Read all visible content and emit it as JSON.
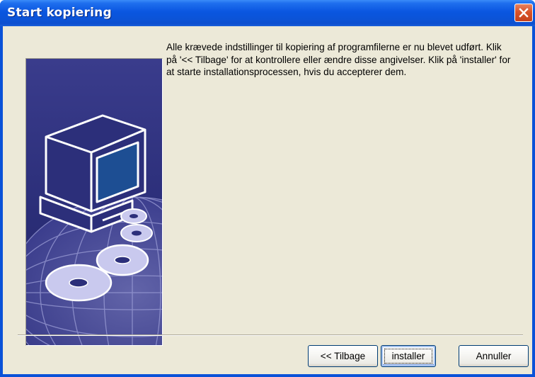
{
  "window": {
    "title": "Start kopiering"
  },
  "icons": {
    "close": "close-icon",
    "illustration": "computer-with-discs-illustration"
  },
  "content": {
    "message": "Alle krævede indstillinger til kopiering af programfilerne er nu blevet udført. Klik på '<< Tilbage' for at kontrollere eller ændre disse angivelser. Klik på 'installer' for at starte installationsprocessen, hvis du accepterer dem."
  },
  "buttons": {
    "back_label": "<< Tilbage",
    "install_label": "installer",
    "cancel_label": "Annuller"
  },
  "colors": {
    "titlebar": "#0a56e0",
    "dialog_bg": "#ece9d8",
    "close_button": "#d9532a",
    "illustration_bg": "#2c2f7a"
  }
}
